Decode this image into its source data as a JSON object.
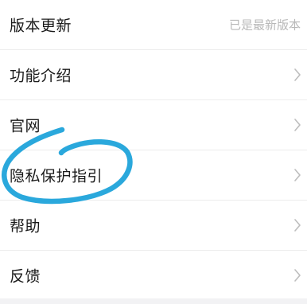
{
  "settings": {
    "items": [
      {
        "label": "版本更新",
        "value": "已是最新版本",
        "has_chevron": false
      },
      {
        "label": "功能介绍",
        "has_chevron": true
      },
      {
        "label": "官网",
        "has_chevron": true
      },
      {
        "label": "隐私保护指引",
        "has_chevron": true
      },
      {
        "label": "帮助",
        "has_chevron": true
      },
      {
        "label": "反馈",
        "has_chevron": true
      }
    ]
  },
  "colors": {
    "text": "#1a1a1a",
    "secondary_text": "#b8b8b8",
    "chevron": "#bdbdbd",
    "divider": "#ececec",
    "annotation_stroke": "#2aa8dc"
  },
  "annotation": {
    "shape": "hand-drawn-circle",
    "target": "隐私保护指引"
  }
}
